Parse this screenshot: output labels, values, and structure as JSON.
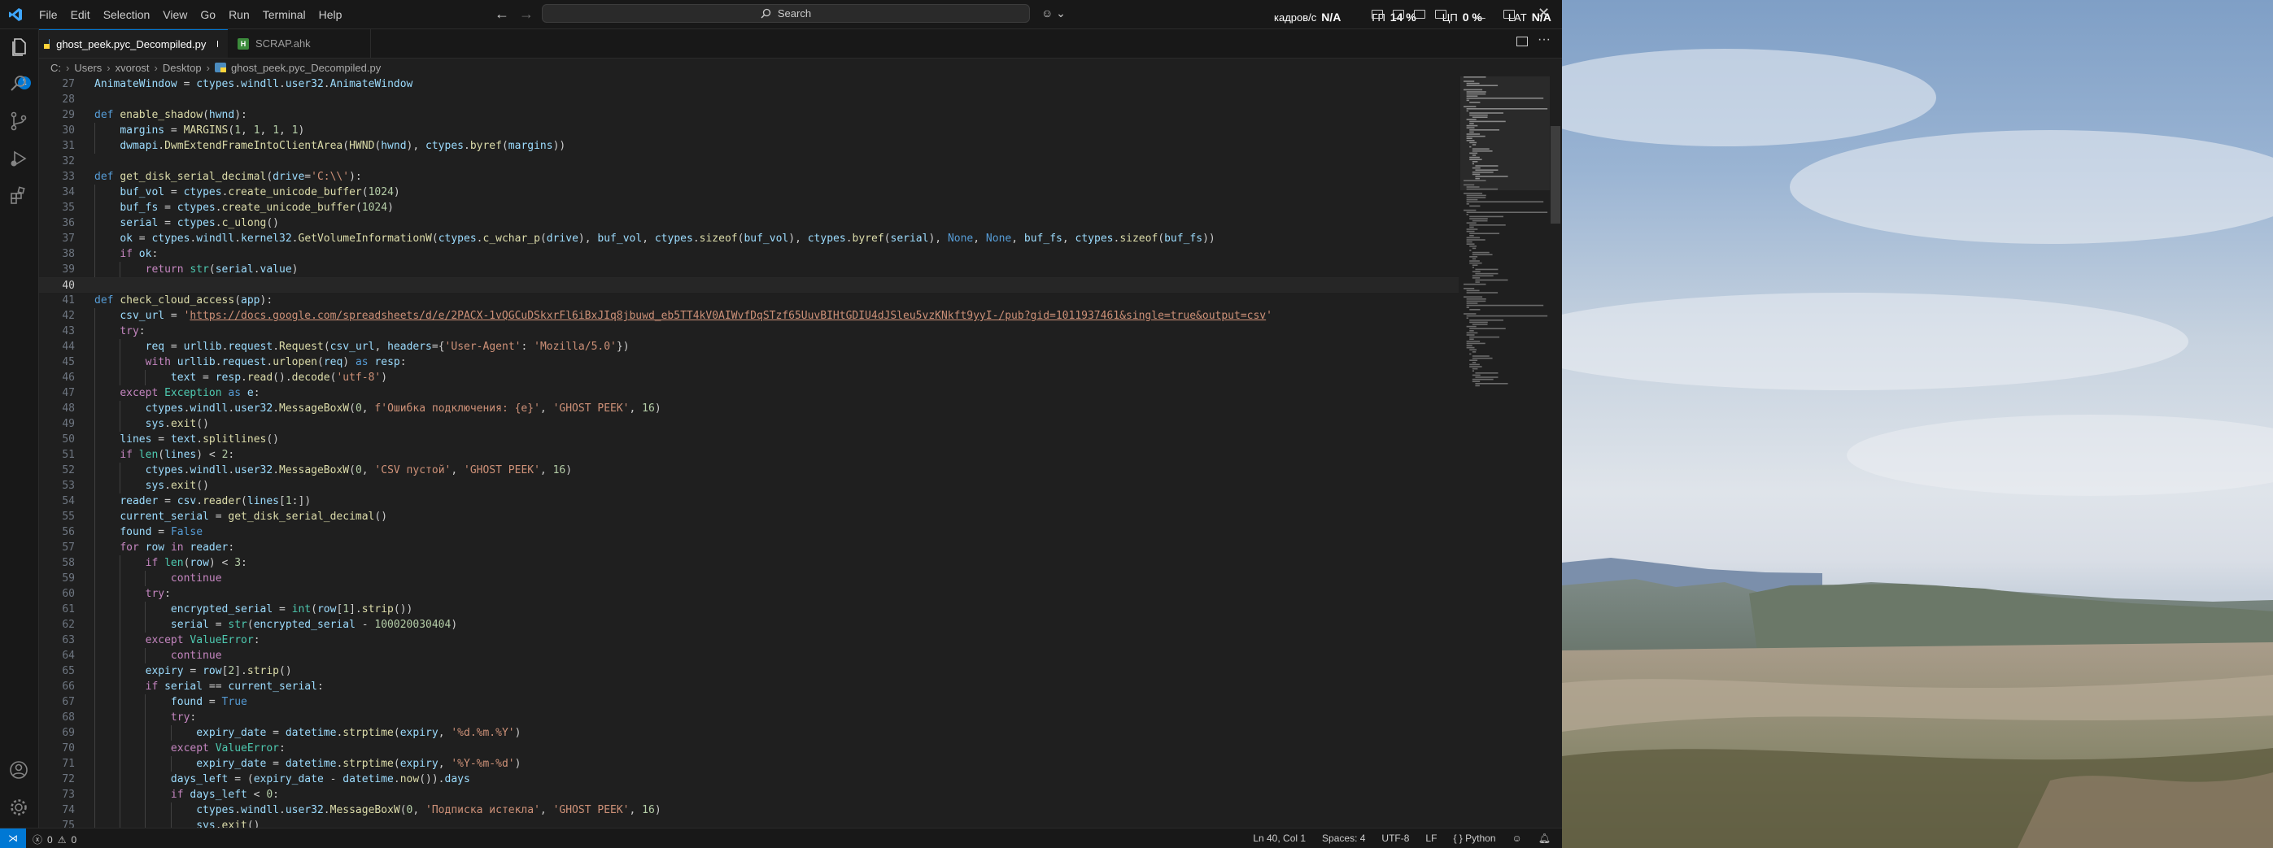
{
  "menu": [
    "File",
    "Edit",
    "Selection",
    "View",
    "Go",
    "Run",
    "Terminal",
    "Help"
  ],
  "search": {
    "label": "Search"
  },
  "overlay": {
    "fps_label": "кадров/с",
    "fps_value": "N/A",
    "gpu_label": "ГП",
    "gpu_value": "14 %",
    "cpu_label": "ЦП",
    "cpu_value": "0 %",
    "lat_label": "LAT",
    "lat_value": "N/A"
  },
  "tabs": [
    {
      "label": "ghost_peek.pyc_Decompiled.py"
    },
    {
      "label": "SCRAP.ahk"
    }
  ],
  "breadcrumb": [
    "C:",
    "Users",
    "xvorost",
    "Desktop",
    "ghost_peek.pyc_Decompiled.py"
  ],
  "activity": {
    "badge": "1"
  },
  "editor": {
    "active_line": "40",
    "lines": [
      {
        "n": "27",
        "t": "AnimateWindow = ctypes.windll.user32.AnimateWindow"
      },
      {
        "n": "28",
        "t": ""
      },
      {
        "n": "29",
        "t": "def enable_shadow(hwnd):"
      },
      {
        "n": "30",
        "t": "    margins = MARGINS(1, 1, 1, 1)"
      },
      {
        "n": "31",
        "t": "    dwmapi.DwmExtendFrameIntoClientArea(HWND(hwnd), ctypes.byref(margins))"
      },
      {
        "n": "32",
        "t": ""
      },
      {
        "n": "33",
        "t": "def get_disk_serial_decimal(drive='C:\\\\'):"
      },
      {
        "n": "34",
        "t": "    buf_vol = ctypes.create_unicode_buffer(1024)"
      },
      {
        "n": "35",
        "t": "    buf_fs = ctypes.create_unicode_buffer(1024)"
      },
      {
        "n": "36",
        "t": "    serial = ctypes.c_ulong()"
      },
      {
        "n": "37",
        "t": "    ok = ctypes.windll.kernel32.GetVolumeInformationW(ctypes.c_wchar_p(drive), buf_vol, ctypes.sizeof(buf_vol), ctypes.byref(serial), None, None, buf_fs, ctypes.sizeof(buf_fs))"
      },
      {
        "n": "38",
        "t": "    if ok:"
      },
      {
        "n": "39",
        "t": "        return str(serial.value)"
      },
      {
        "n": "40",
        "t": ""
      },
      {
        "n": "41",
        "t": "def check_cloud_access(app):"
      },
      {
        "n": "42",
        "t": "    csv_url = 'https://docs.google.com/spreadsheets/d/e/2PACX-1vQGCuDSkxrFl6iBxJIq8jbuwd_eb5TT4kV0AIWvfDqSTzf65UuvBIHtGDIU4dJSleu5vzKNkft9yyI-/pub?gid=1011937461&single=true&output=csv'"
      },
      {
        "n": "43",
        "t": "    try:"
      },
      {
        "n": "44",
        "t": "        req = urllib.request.Request(csv_url, headers={'User-Agent': 'Mozilla/5.0'})"
      },
      {
        "n": "45",
        "t": "        with urllib.request.urlopen(req) as resp:"
      },
      {
        "n": "46",
        "t": "            text = resp.read().decode('utf-8')"
      },
      {
        "n": "47",
        "t": "    except Exception as e:"
      },
      {
        "n": "48",
        "t": "        ctypes.windll.user32.MessageBoxW(0, f'Ошибка подключения: {e}', 'GHOST PEEK', 16)"
      },
      {
        "n": "49",
        "t": "        sys.exit()"
      },
      {
        "n": "50",
        "t": "    lines = text.splitlines()"
      },
      {
        "n": "51",
        "t": "    if len(lines) < 2:"
      },
      {
        "n": "52",
        "t": "        ctypes.windll.user32.MessageBoxW(0, 'CSV пустой', 'GHOST PEEK', 16)"
      },
      {
        "n": "53",
        "t": "        sys.exit()"
      },
      {
        "n": "54",
        "t": "    reader = csv.reader(lines[1:])"
      },
      {
        "n": "55",
        "t": "    current_serial = get_disk_serial_decimal()"
      },
      {
        "n": "56",
        "t": "    found = False"
      },
      {
        "n": "57",
        "t": "    for row in reader:"
      },
      {
        "n": "58",
        "t": "        if len(row) < 3:"
      },
      {
        "n": "59",
        "t": "            continue"
      },
      {
        "n": "60",
        "t": "        try:"
      },
      {
        "n": "61",
        "t": "            encrypted_serial = int(row[1].strip())"
      },
      {
        "n": "62",
        "t": "            serial = str(encrypted_serial - 100020030404)"
      },
      {
        "n": "63",
        "t": "        except ValueError:"
      },
      {
        "n": "64",
        "t": "            continue"
      },
      {
        "n": "65",
        "t": "        expiry = row[2].strip()"
      },
      {
        "n": "66",
        "t": "        if serial == current_serial:"
      },
      {
        "n": "67",
        "t": "            found = True"
      },
      {
        "n": "68",
        "t": "            try:"
      },
      {
        "n": "69",
        "t": "                expiry_date = datetime.strptime(expiry, '%d.%m.%Y')"
      },
      {
        "n": "70",
        "t": "            except ValueError:"
      },
      {
        "n": "71",
        "t": "                expiry_date = datetime.strptime(expiry, '%Y-%m-%d')"
      },
      {
        "n": "72",
        "t": "            days_left = (expiry_date - datetime.now()).days"
      },
      {
        "n": "73",
        "t": "            if days_left < 0:"
      },
      {
        "n": "74",
        "t": "                ctypes.windll.user32.MessageBoxW(0, 'Подписка истекла', 'GHOST PEEK', 16)"
      },
      {
        "n": "75",
        "t": "                sys.exit()"
      }
    ]
  },
  "statusbar": {
    "errors": "0",
    "warnings": "0",
    "position": "Ln 40, Col 1",
    "spaces": "Spaces: 4",
    "encoding": "UTF-8",
    "eol": "LF",
    "language": "Python"
  }
}
